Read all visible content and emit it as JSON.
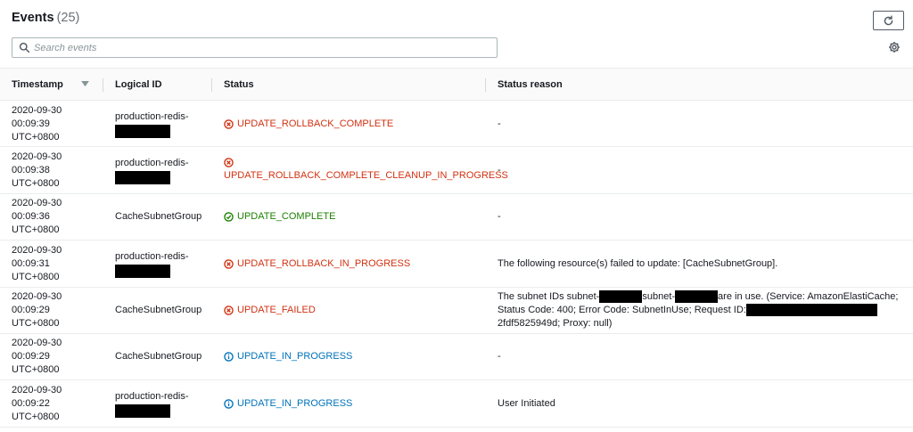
{
  "header": {
    "title": "Events",
    "count": "(25)"
  },
  "search": {
    "placeholder": "Search events",
    "value": ""
  },
  "icons": {
    "refresh": "refresh-icon",
    "settings": "gear-icon",
    "search": "search-icon",
    "sort": "sort-down-icon"
  },
  "colors": {
    "fail": "#d13212",
    "success": "#1d8102",
    "info": "#0073bb"
  },
  "table": {
    "columns": [
      "Timestamp",
      "Logical ID",
      "Status",
      "Status reason"
    ],
    "rows": [
      {
        "ts": [
          "2020-09-30",
          "00:09:39",
          "UTC+0800"
        ],
        "logical_id": "production-redis-",
        "status": "UPDATE_ROLLBACK_COMPLETE",
        "reason": "-"
      },
      {
        "ts": [
          "2020-09-30",
          "00:09:38",
          "UTC+0800"
        ],
        "logical_id": "production-redis-",
        "status": "UPDATE_ROLLBACK_COMPLETE_CLEANUP_IN_PROGRESS",
        "reason": "-"
      },
      {
        "ts": [
          "2020-09-30",
          "00:09:36",
          "UTC+0800"
        ],
        "logical_id": "CacheSubnetGroup",
        "status": "UPDATE_COMPLETE",
        "reason": "-"
      },
      {
        "ts": [
          "2020-09-30",
          "00:09:31",
          "UTC+0800"
        ],
        "logical_id": "production-redis-",
        "status": "UPDATE_ROLLBACK_IN_PROGRESS",
        "reason": "The following resource(s) failed to update: [CacheSubnetGroup]."
      },
      {
        "ts": [
          "2020-09-30",
          "00:09:29",
          "UTC+0800"
        ],
        "logical_id": "CacheSubnetGroup",
        "status": "UPDATE_FAILED",
        "reason_parts": [
          "The subnet IDs subnet-",
          "subnet-",
          "are in use. (Service: AmazonElastiCache;",
          "Status Code: 400; Error Code: SubnetInUse; Request ID:",
          "2fdf5825949d; Proxy: null)"
        ]
      },
      {
        "ts": [
          "2020-09-30",
          "00:09:29",
          "UTC+0800"
        ],
        "logical_id": "CacheSubnetGroup",
        "status": "UPDATE_IN_PROGRESS",
        "reason": "-"
      },
      {
        "ts": [
          "2020-09-30",
          "00:09:22",
          "UTC+0800"
        ],
        "logical_id": "production-redis-",
        "status": "UPDATE_IN_PROGRESS",
        "reason": "User Initiated"
      }
    ]
  }
}
